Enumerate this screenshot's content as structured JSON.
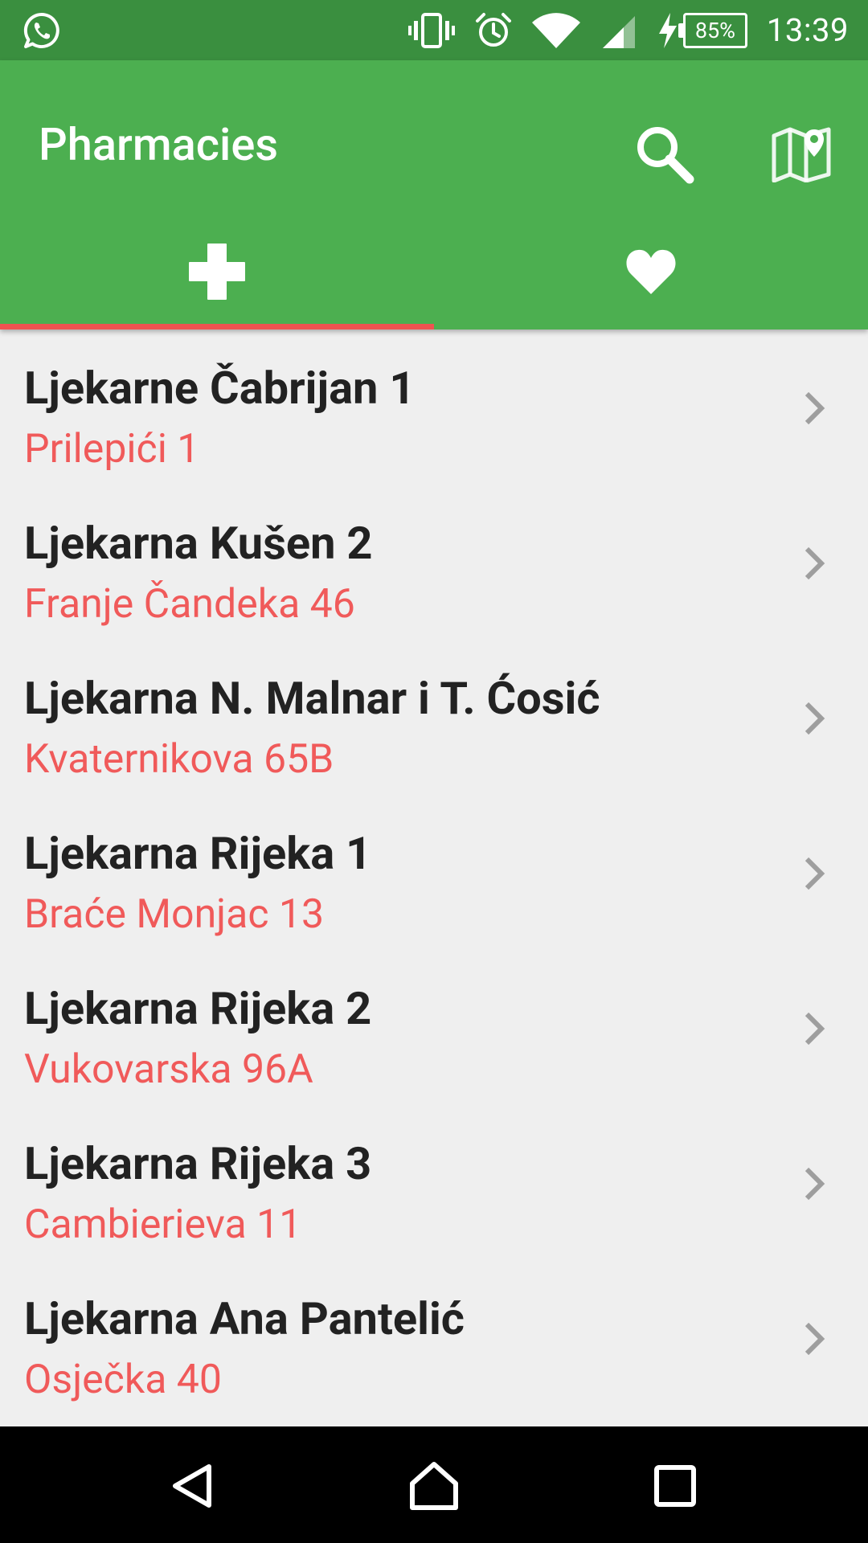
{
  "status_bar": {
    "battery": "85%",
    "time": "13:39",
    "icons": [
      "whatsapp-icon",
      "vibrate-icon",
      "alarm-icon",
      "wifi-icon",
      "signal-icon",
      "charging-icon",
      "battery-icon"
    ]
  },
  "app_bar": {
    "title": "Pharmacies",
    "actions": [
      "search-icon",
      "map-icon"
    ],
    "color": "#4caf50"
  },
  "tabs": [
    {
      "icon": "plus-icon",
      "active": true
    },
    {
      "icon": "heart-icon",
      "active": false
    }
  ],
  "accent_color": "#f05a5a",
  "pharmacies": [
    {
      "name": "Ljekarne Čabrijan 1",
      "address": "Prilepići 1"
    },
    {
      "name": "Ljekarna Kušen 2",
      "address": "Franje Čandeka 46"
    },
    {
      "name": "Ljekarna N. Malnar i T. Ćosić",
      "address": "Kvaternikova 65B"
    },
    {
      "name": "Ljekarna Rijeka 1",
      "address": "Braće Monjac 13"
    },
    {
      "name": "Ljekarna Rijeka 2",
      "address": "Vukovarska 96A"
    },
    {
      "name": "Ljekarna Rijeka 3",
      "address": "Cambierieva 11"
    },
    {
      "name": "Ljekarna Ana Pantelić",
      "address": "Osječka 40"
    }
  ],
  "nav_bar": [
    "back-icon",
    "home-icon",
    "recents-icon"
  ]
}
